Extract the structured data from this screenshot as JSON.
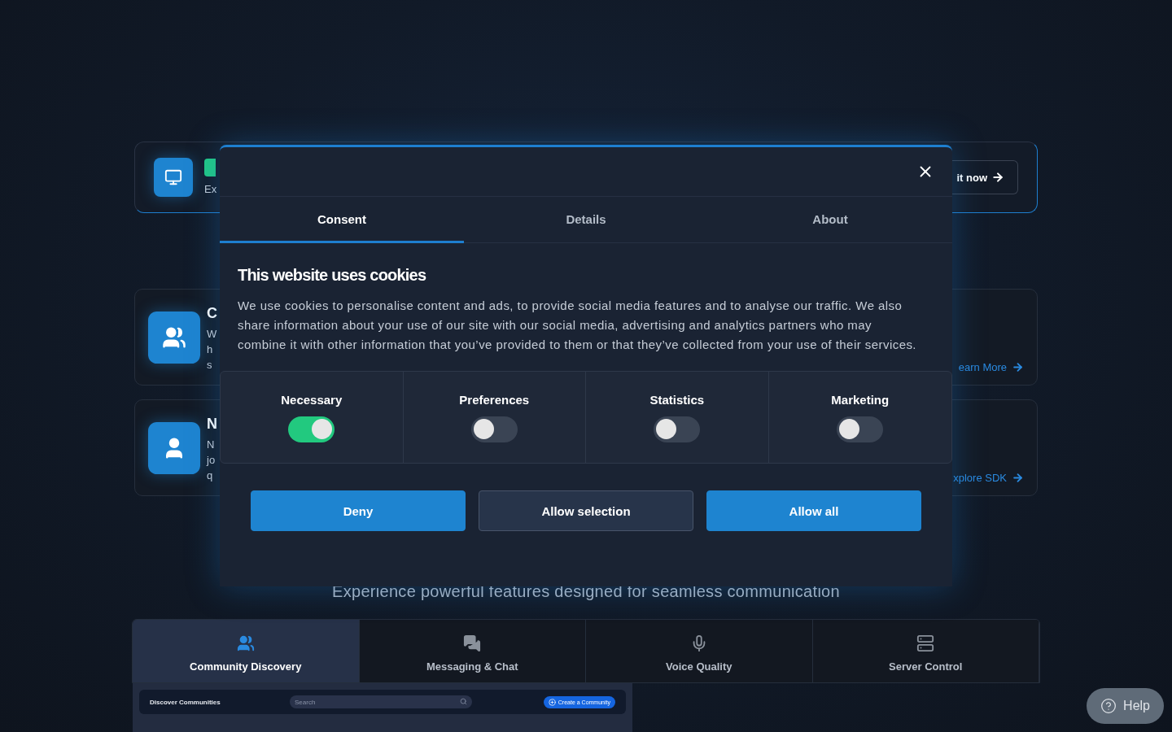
{
  "page": {
    "promo": {
      "text": "Ex",
      "button": "it now"
    },
    "features": [
      {
        "kind": "group",
        "heading": "C",
        "lines": [
          "W",
          "h",
          "s"
        ],
        "link": "earn More"
      },
      {
        "kind": "person",
        "heading": "N",
        "lines": [
          "N",
          "jo",
          "q"
        ],
        "link": "xplore SDK"
      }
    ],
    "subtitle": "Experience powerful features designed for seamless communication",
    "feature_tabs": [
      {
        "kind": "group",
        "label": "Community Discovery",
        "selected": true
      },
      {
        "kind": "chat",
        "label": "Messaging & Chat",
        "selected": false
      },
      {
        "kind": "mic",
        "label": "Voice Quality",
        "selected": false
      },
      {
        "kind": "server",
        "label": "Server Control",
        "selected": false
      }
    ],
    "preview": {
      "title": "Discover Communities",
      "search_placeholder": "Search",
      "button": "Create a Community"
    }
  },
  "cookie_dialog": {
    "tabs": [
      {
        "label": "Consent",
        "selected": true
      },
      {
        "label": "Details",
        "selected": false
      },
      {
        "label": "About",
        "selected": false
      }
    ],
    "title": "This website uses cookies",
    "text": "We use cookies to personalise content and ads, to provide social media features and to analyse our traffic. We also share information about your use of our site with our social media, advertising and analytics partners who may combine it with other information that you’ve provided to them or that they’ve collected from your use of their services.",
    "categories": [
      {
        "label": "Necessary",
        "on": true
      },
      {
        "label": "Preferences",
        "on": false
      },
      {
        "label": "Statistics",
        "on": false
      },
      {
        "label": "Marketing",
        "on": false
      }
    ],
    "buttons": [
      {
        "label": "Deny",
        "kind": "primary"
      },
      {
        "label": "Allow selection",
        "kind": "secondary"
      },
      {
        "label": "Allow all",
        "kind": "primary"
      }
    ]
  },
  "help_button": "Help"
}
